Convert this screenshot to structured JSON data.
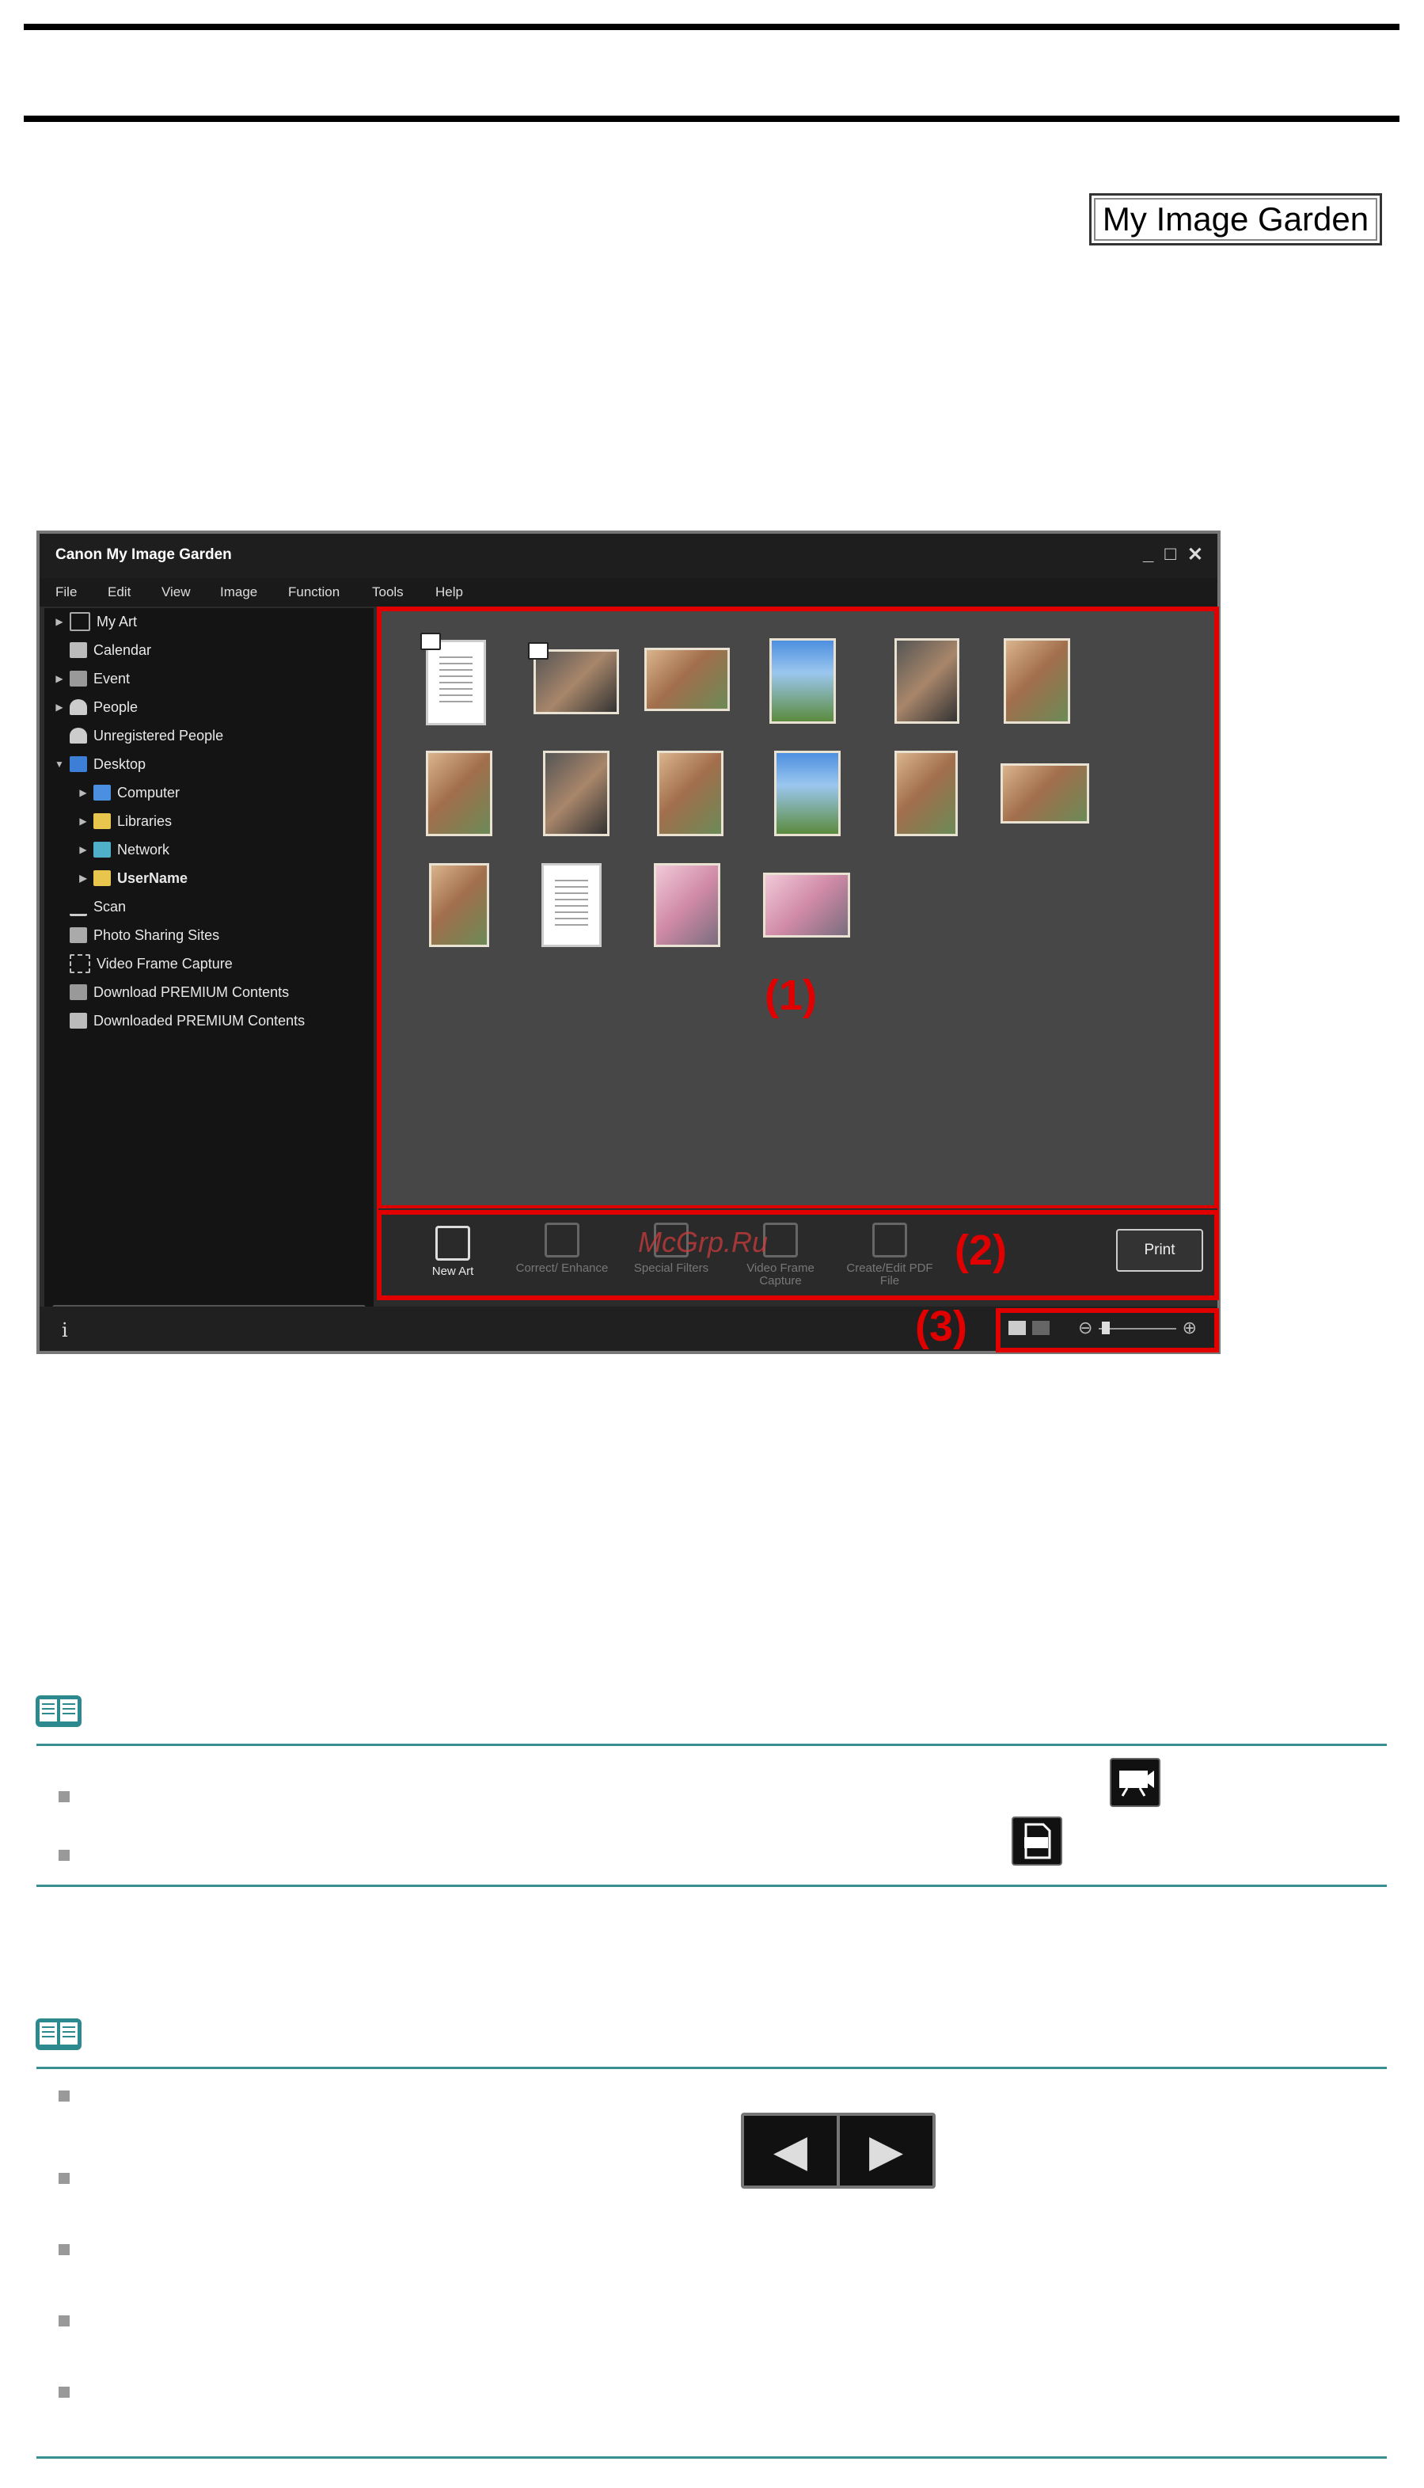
{
  "header": {
    "badge": "My Image Garden"
  },
  "app": {
    "title": "Canon My Image Garden",
    "window_controls": [
      "_",
      "□",
      "✕"
    ],
    "menu": [
      "File",
      "Edit",
      "View",
      "Image",
      "Function",
      "Tools",
      "Help"
    ],
    "tree": [
      {
        "label": "My Art",
        "expandable": true,
        "level": 0,
        "icon": "art-icon"
      },
      {
        "label": "Calendar",
        "expandable": false,
        "level": 0,
        "icon": "calendar-icon"
      },
      {
        "label": "Event",
        "expandable": true,
        "level": 0,
        "icon": "event-icon"
      },
      {
        "label": "People",
        "expandable": true,
        "level": 0,
        "icon": "person-icon"
      },
      {
        "label": "Unregistered People",
        "expandable": false,
        "level": 0,
        "icon": "person-icon"
      },
      {
        "label": "Desktop",
        "expandable": true,
        "expanded": true,
        "level": 0,
        "icon": "desktop-icon"
      },
      {
        "label": "Computer",
        "expandable": true,
        "level": 1,
        "icon": "computer-icon"
      },
      {
        "label": "Libraries",
        "expandable": true,
        "level": 1,
        "icon": "folder-icon"
      },
      {
        "label": "Network",
        "expandable": true,
        "level": 1,
        "icon": "network-icon"
      },
      {
        "label": "UserName",
        "expandable": true,
        "level": 1,
        "bold": true,
        "icon": "user-folder-icon"
      },
      {
        "label": "Scan",
        "expandable": false,
        "level": 0,
        "icon": "scan-icon"
      },
      {
        "label": "Photo Sharing Sites",
        "expandable": false,
        "level": 0,
        "icon": "sharing-icon"
      },
      {
        "label": "Video Frame Capture",
        "expandable": false,
        "level": 0,
        "icon": "video-icon"
      },
      {
        "label": "Download PREMIUM Contents",
        "expandable": false,
        "level": 0,
        "icon": "download-icon"
      },
      {
        "label": "Downloaded PREMIUM Contents",
        "expandable": false,
        "level": 0,
        "icon": "folder-icon"
      }
    ],
    "toolbar": {
      "new_art": "New Art",
      "correct": "Correct/ Enhance",
      "special": "Special Filters",
      "video": "Video Frame Capture",
      "pdf": "Create/Edit PDF File",
      "print": "Print"
    },
    "callouts": [
      "(1)",
      "(2)",
      "(3)"
    ],
    "watermark": "McGrp.Ru",
    "status_info": "i"
  }
}
